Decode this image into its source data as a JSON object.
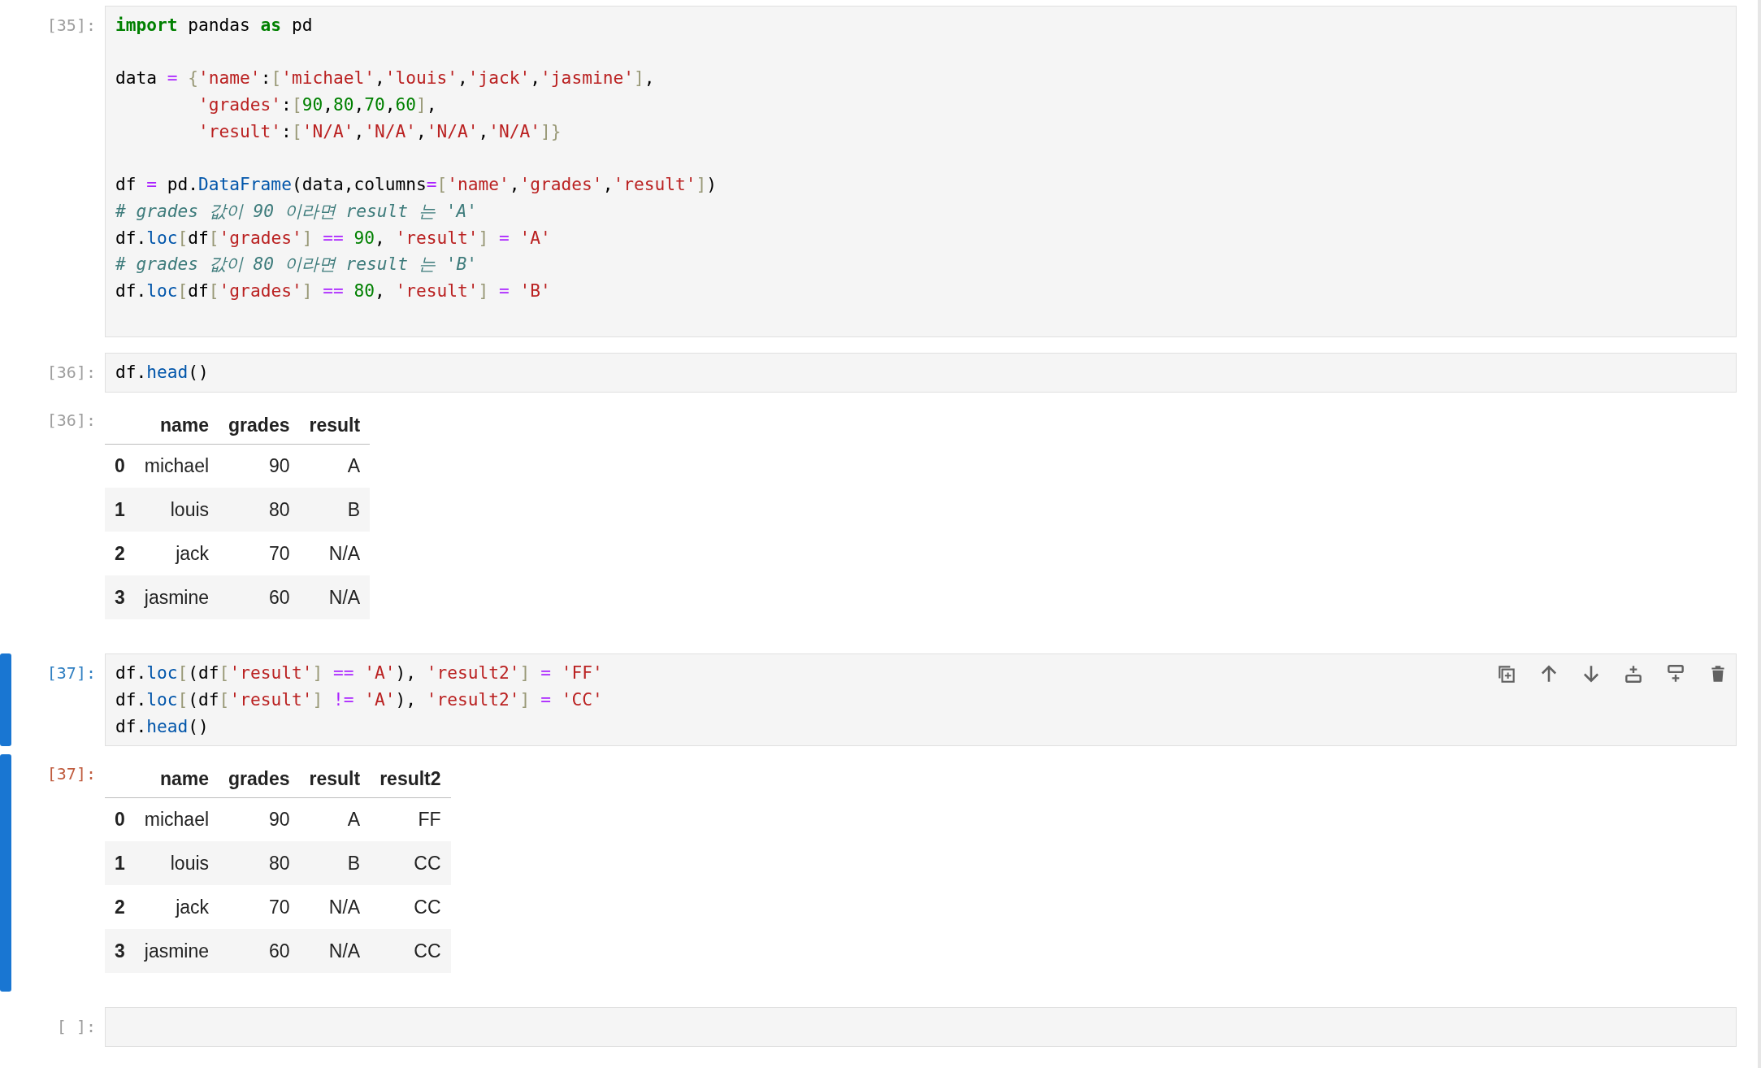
{
  "cells": [
    {
      "active": false,
      "input": {
        "prompt": "[35]:",
        "trailing_blank_line": true,
        "blocks": [
          [
            [
              {
                "kind": "keyword",
                "text": "import"
              },
              {
                "kind": "plain",
                "text": " pandas "
              },
              {
                "kind": "keyword",
                "text": "as"
              },
              {
                "kind": "plain",
                "text": " pd"
              }
            ]
          ],
          [
            [
              {
                "kind": "plain",
                "text": "data"
              },
              {
                "kind": "operator",
                "text": " = "
              },
              {
                "kind": "bracket",
                "text": "{"
              },
              {
                "kind": "string",
                "text": "'name'"
              },
              {
                "kind": "plain",
                "text": ":"
              },
              {
                "kind": "bracket",
                "text": "["
              },
              {
                "kind": "string",
                "text": "'michael'"
              },
              {
                "kind": "plain",
                "text": ","
              },
              {
                "kind": "string",
                "text": "'louis'"
              },
              {
                "kind": "plain",
                "text": ","
              },
              {
                "kind": "string",
                "text": "'jack'"
              },
              {
                "kind": "plain",
                "text": ","
              },
              {
                "kind": "string",
                "text": "'jasmine'"
              },
              {
                "kind": "bracket",
                "text": "]"
              },
              {
                "kind": "plain",
                "text": ","
              }
            ],
            [
              {
                "kind": "string",
                "text": "        'grades'"
              },
              {
                "kind": "plain",
                "text": ":"
              },
              {
                "kind": "bracket",
                "text": "["
              },
              {
                "kind": "number",
                "text": "90"
              },
              {
                "kind": "plain",
                "text": ","
              },
              {
                "kind": "number",
                "text": "80"
              },
              {
                "kind": "plain",
                "text": ","
              },
              {
                "kind": "number",
                "text": "70"
              },
              {
                "kind": "plain",
                "text": ","
              },
              {
                "kind": "number",
                "text": "60"
              },
              {
                "kind": "bracket",
                "text": "]"
              },
              {
                "kind": "plain",
                "text": ","
              }
            ],
            [
              {
                "kind": "string",
                "text": "        'result'"
              },
              {
                "kind": "plain",
                "text": ":"
              },
              {
                "kind": "bracket",
                "text": "["
              },
              {
                "kind": "string",
                "text": "'N/A'"
              },
              {
                "kind": "plain",
                "text": ","
              },
              {
                "kind": "string",
                "text": "'N/A'"
              },
              {
                "kind": "plain",
                "text": ","
              },
              {
                "kind": "string",
                "text": "'N/A'"
              },
              {
                "kind": "plain",
                "text": ","
              },
              {
                "kind": "string",
                "text": "'N/A'"
              },
              {
                "kind": "bracket",
                "text": "]}"
              }
            ]
          ],
          [
            [
              {
                "kind": "plain",
                "text": "df"
              },
              {
                "kind": "operator",
                "text": " = "
              },
              {
                "kind": "plain",
                "text": "pd."
              },
              {
                "kind": "name",
                "text": "DataFrame"
              },
              {
                "kind": "plain",
                "text": "(data,columns"
              },
              {
                "kind": "operator",
                "text": "="
              },
              {
                "kind": "bracket",
                "text": "["
              },
              {
                "kind": "string",
                "text": "'name'"
              },
              {
                "kind": "plain",
                "text": ","
              },
              {
                "kind": "string",
                "text": "'grades'"
              },
              {
                "kind": "plain",
                "text": ","
              },
              {
                "kind": "string",
                "text": "'result'"
              },
              {
                "kind": "bracket",
                "text": "]"
              },
              {
                "kind": "plain",
                "text": ")"
              }
            ],
            [
              {
                "kind": "comment",
                "text": "# grades 값이 90 이라면 result 는 'A'"
              }
            ],
            [
              {
                "kind": "plain",
                "text": "df."
              },
              {
                "kind": "name",
                "text": "loc"
              },
              {
                "kind": "bracket",
                "text": "["
              },
              {
                "kind": "plain",
                "text": "df"
              },
              {
                "kind": "bracket",
                "text": "["
              },
              {
                "kind": "string",
                "text": "'grades'"
              },
              {
                "kind": "bracket",
                "text": "]"
              },
              {
                "kind": "operator",
                "text": " == "
              },
              {
                "kind": "number",
                "text": "90"
              },
              {
                "kind": "plain",
                "text": ", "
              },
              {
                "kind": "string",
                "text": "'result'"
              },
              {
                "kind": "bracket",
                "text": "]"
              },
              {
                "kind": "operator",
                "text": " = "
              },
              {
                "kind": "string",
                "text": "'A'"
              }
            ],
            [
              {
                "kind": "comment",
                "text": "# grades 값이 80 이라면 result 는 'B'"
              }
            ],
            [
              {
                "kind": "plain",
                "text": "df."
              },
              {
                "kind": "name",
                "text": "loc"
              },
              {
                "kind": "bracket",
                "text": "["
              },
              {
                "kind": "plain",
                "text": "df"
              },
              {
                "kind": "bracket",
                "text": "["
              },
              {
                "kind": "string",
                "text": "'grades'"
              },
              {
                "kind": "bracket",
                "text": "]"
              },
              {
                "kind": "operator",
                "text": " == "
              },
              {
                "kind": "number",
                "text": "80"
              },
              {
                "kind": "plain",
                "text": ", "
              },
              {
                "kind": "string",
                "text": "'result'"
              },
              {
                "kind": "bracket",
                "text": "]"
              },
              {
                "kind": "operator",
                "text": " = "
              },
              {
                "kind": "string",
                "text": "'B'"
              }
            ]
          ]
        ]
      }
    },
    {
      "active": false,
      "input": {
        "prompt": "[36]:",
        "blocks": [
          [
            [
              {
                "kind": "plain",
                "text": "df."
              },
              {
                "kind": "name",
                "text": "head"
              },
              {
                "kind": "plain",
                "text": "()"
              }
            ]
          ]
        ]
      },
      "output": {
        "prompt": "[36]:",
        "table": {
          "columns": [
            "name",
            "grades",
            "result"
          ],
          "rows": [
            {
              "index": "0",
              "cells": [
                "michael",
                "90",
                "A"
              ]
            },
            {
              "index": "1",
              "cells": [
                "louis",
                "80",
                "B"
              ]
            },
            {
              "index": "2",
              "cells": [
                "jack",
                "70",
                "N/A"
              ]
            },
            {
              "index": "3",
              "cells": [
                "jasmine",
                "60",
                "N/A"
              ]
            }
          ]
        }
      }
    },
    {
      "active": true,
      "input": {
        "prompt": "[37]:",
        "blocks": [
          [
            [
              {
                "kind": "plain",
                "text": "df."
              },
              {
                "kind": "name",
                "text": "loc"
              },
              {
                "kind": "bracket",
                "text": "["
              },
              {
                "kind": "plain",
                "text": "(df"
              },
              {
                "kind": "bracket",
                "text": "["
              },
              {
                "kind": "string",
                "text": "'result'"
              },
              {
                "kind": "bracket",
                "text": "]"
              },
              {
                "kind": "operator",
                "text": " == "
              },
              {
                "kind": "string",
                "text": "'A'"
              },
              {
                "kind": "plain",
                "text": "), "
              },
              {
                "kind": "string",
                "text": "'result2'"
              },
              {
                "kind": "bracket",
                "text": "]"
              },
              {
                "kind": "operator",
                "text": " = "
              },
              {
                "kind": "string",
                "text": "'FF'"
              }
            ],
            [
              {
                "kind": "plain",
                "text": "df."
              },
              {
                "kind": "name",
                "text": "loc"
              },
              {
                "kind": "bracket",
                "text": "["
              },
              {
                "kind": "plain",
                "text": "(df"
              },
              {
                "kind": "bracket",
                "text": "["
              },
              {
                "kind": "string",
                "text": "'result'"
              },
              {
                "kind": "bracket",
                "text": "]"
              },
              {
                "kind": "operator",
                "text": " != "
              },
              {
                "kind": "string",
                "text": "'A'"
              },
              {
                "kind": "plain",
                "text": "), "
              },
              {
                "kind": "string",
                "text": "'result2'"
              },
              {
                "kind": "bracket",
                "text": "]"
              },
              {
                "kind": "operator",
                "text": " = "
              },
              {
                "kind": "string",
                "text": "'CC'"
              }
            ],
            [
              {
                "kind": "plain",
                "text": "df."
              },
              {
                "kind": "name",
                "text": "head"
              },
              {
                "kind": "plain",
                "text": "()"
              }
            ]
          ]
        ]
      },
      "output": {
        "prompt": "[37]:",
        "table": {
          "columns": [
            "name",
            "grades",
            "result",
            "result2"
          ],
          "rows": [
            {
              "index": "0",
              "cells": [
                "michael",
                "90",
                "A",
                "FF"
              ]
            },
            {
              "index": "1",
              "cells": [
                "louis",
                "80",
                "B",
                "CC"
              ]
            },
            {
              "index": "2",
              "cells": [
                "jack",
                "70",
                "N/A",
                "CC"
              ]
            },
            {
              "index": "3",
              "cells": [
                "jasmine",
                "60",
                "N/A",
                "CC"
              ]
            }
          ]
        }
      }
    },
    {
      "active": false,
      "input": {
        "prompt": "[ ]:"
      }
    }
  ]
}
